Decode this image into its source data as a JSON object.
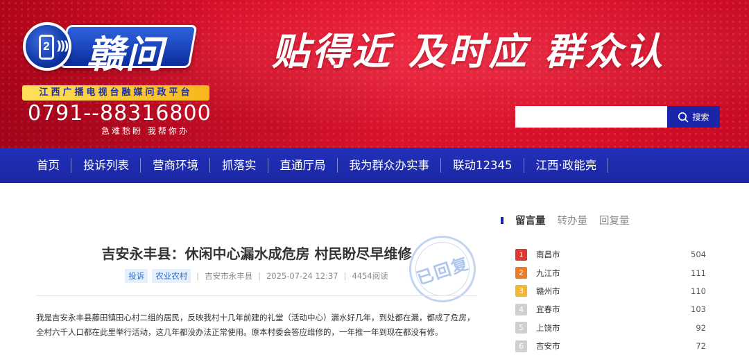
{
  "header": {
    "logo_text": "赣问",
    "logo_badge": "2",
    "platform": "江西广播电视台融媒问政平台",
    "hotline": "0791--88316800",
    "hotline_slogan": "急难愁盼  我帮你办",
    "slogan": "贴得近  及时应  群众认",
    "search": {
      "value": "",
      "button_label": "搜索"
    }
  },
  "nav": {
    "items": [
      {
        "label": "首页"
      },
      {
        "label": "投诉列表"
      },
      {
        "label": "营商环境"
      },
      {
        "label": "抓落实"
      },
      {
        "label": "直通厅局"
      },
      {
        "label": "我为群众办实事"
      },
      {
        "label": "联动12345"
      },
      {
        "label": "江西·政能亮"
      }
    ]
  },
  "article": {
    "title": "吉安永丰县：休闲中心漏水成危房 村民盼尽早维修",
    "tags": [
      "投诉",
      "农业农村"
    ],
    "location": "吉安市永丰县",
    "datetime": "2025-07-24 12:37",
    "reads": "4454阅读",
    "stamp": "已回复",
    "body": "我是吉安永丰县藤田镇田心村二组的居民，反映我村十几年前建的礼堂（活动中心）漏水好几年，到处都在漏，都成了危房，全村六千人口都在此里举行活动，这几年都没办法正常使用。原本村委会答应维修的，一年推一年到现在都没有修。"
  },
  "sidebar": {
    "tabs": [
      {
        "label": "留言量",
        "active": true
      },
      {
        "label": "转办量",
        "active": false
      },
      {
        "label": "回复量",
        "active": false
      }
    ],
    "ranking": [
      {
        "rank": "1",
        "city": "南昌市",
        "count": "504",
        "color": "#e0372e"
      },
      {
        "rank": "2",
        "city": "九江市",
        "count": "111",
        "color": "#f07a22"
      },
      {
        "rank": "3",
        "city": "赣州市",
        "count": "110",
        "color": "#f5b731"
      },
      {
        "rank": "4",
        "city": "宜春市",
        "count": "103",
        "color": "#cfcfcf"
      },
      {
        "rank": "5",
        "city": "上饶市",
        "count": "92",
        "color": "#cfcfcf"
      },
      {
        "rank": "6",
        "city": "吉安市",
        "count": "72",
        "color": "#cfcfcf"
      }
    ]
  }
}
